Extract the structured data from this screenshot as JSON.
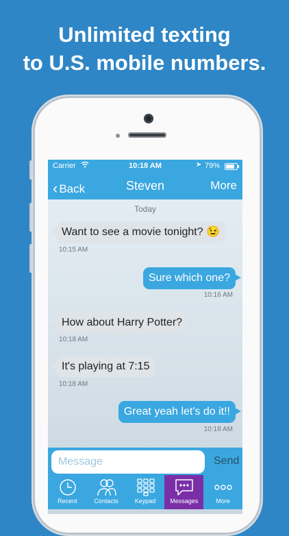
{
  "headline": {
    "line1": "Unlimited texting",
    "line2": "to U.S. mobile numbers."
  },
  "status_bar": {
    "carrier": "Carrier",
    "time": "10:18 AM",
    "battery": "79%"
  },
  "nav": {
    "back": "Back",
    "title": "Steven",
    "more": "More"
  },
  "date_divider": "Today",
  "messages": [
    {
      "direction": "in",
      "text": "Want to see a movie tonight? 😉",
      "time": "10:15 AM"
    },
    {
      "direction": "out",
      "text": "Sure which one?",
      "time": "10:16 AM"
    },
    {
      "direction": "in",
      "text": "How about Harry Potter?",
      "time": "10:18 AM"
    },
    {
      "direction": "in",
      "text": "It's playing at 7:15",
      "time": "10:18 AM"
    },
    {
      "direction": "out",
      "text": "Great yeah let's do it!!",
      "time": "10:18 AM"
    }
  ],
  "composer": {
    "placeholder": "Message",
    "send": "Send"
  },
  "tabs": [
    {
      "label": "Recent",
      "icon": "clock-icon"
    },
    {
      "label": "Contacts",
      "icon": "contacts-icon"
    },
    {
      "label": "Keypad",
      "icon": "keypad-icon"
    },
    {
      "label": "Messages",
      "icon": "messages-icon",
      "active": true
    },
    {
      "label": "More",
      "icon": "more-icon"
    }
  ],
  "colors": {
    "background": "#2f86c6",
    "accent": "#3aa7e0",
    "active_tab": "#7a2fa7",
    "incoming_bubble": "#dfe4e8"
  }
}
